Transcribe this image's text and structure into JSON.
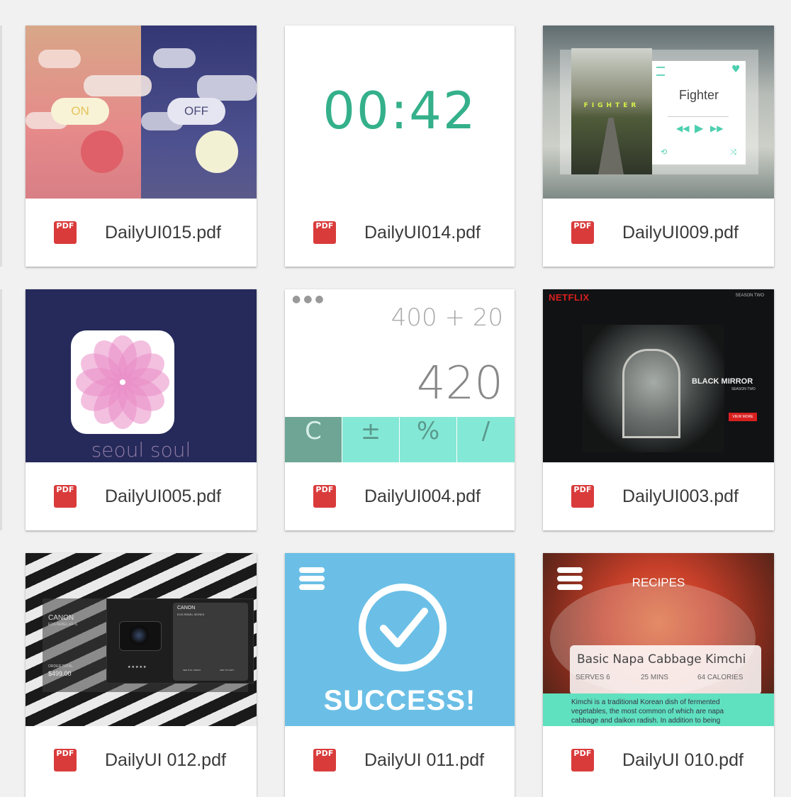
{
  "files": [
    {
      "name": "DailyUI015.pdf",
      "badge": "PDF"
    },
    {
      "name": "DailyUI014.pdf",
      "badge": "PDF"
    },
    {
      "name": "DailyUI009.pdf",
      "badge": "PDF"
    },
    {
      "name": "DailyUI005.pdf",
      "badge": "PDF"
    },
    {
      "name": "DailyUI004.pdf",
      "badge": "PDF"
    },
    {
      "name": "DailyUI003.pdf",
      "badge": "PDF"
    },
    {
      "name": "DailyUI 012.pdf",
      "badge": "PDF"
    },
    {
      "name": "DailyUI 011.pdf",
      "badge": "PDF"
    },
    {
      "name": "DailyUI 010.pdf",
      "badge": "PDF"
    }
  ],
  "thumbs": {
    "toggle": {
      "on": "ON",
      "off": "OFF"
    },
    "timer": {
      "time": "00:42"
    },
    "music": {
      "title": "Fighter",
      "poster_title": "FIGHTER"
    },
    "app": {
      "caption": "seoul soul"
    },
    "calc": {
      "expression": "400 + 20",
      "result": "420",
      "keys": [
        "C",
        "±",
        "%",
        "/"
      ]
    },
    "netflix": {
      "logo": "NETFLIX",
      "season": "SEASON TWO",
      "show": "BLACK MIRROR",
      "season_label": "SEASON TWO",
      "button": "VIEW MORE"
    },
    "camera": {
      "brand": "CANON",
      "series": "EOS REBEL EF-S",
      "order_total_label": "ORDER TOTAL",
      "order_total": "$499.00",
      "panel_brand": "CANON",
      "panel_series": "EOS REBEL SERIES",
      "see_specs": "SEE FULL SPECS",
      "add_to_cart": "ADD TO CART",
      "stars": "★★★★★"
    },
    "success": {
      "text": "SUCCESS!"
    },
    "recipe": {
      "header": "RECIPES",
      "title": "Basic Napa Cabbage Kimchi",
      "serves": "SERVES 6",
      "time": "25 MINS",
      "calories": "64 CALORIES",
      "description": "Kimchi is a traditional Korean dish of fermented vegetables, the most common of which are napa cabbage and daikon radish. In addition to being"
    }
  },
  "colors": {
    "pdf_badge": "#d93b3b",
    "timer_green": "#34b08a",
    "calc_mint": "#84e8d6",
    "calc_dark": "#6ea594",
    "success_blue": "#6bbfe6"
  }
}
